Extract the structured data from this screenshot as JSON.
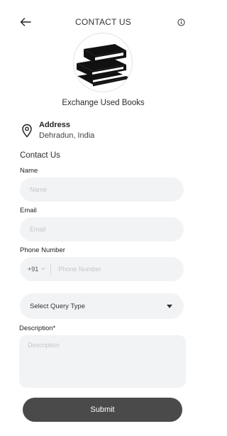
{
  "header": {
    "title": "CONTACT US",
    "back_icon": "arrow-left-icon",
    "info_icon": "info-icon"
  },
  "brand": {
    "name": "Exchange Used Books",
    "logo_icon": "books-stack-icon"
  },
  "address": {
    "icon": "location-pin-icon",
    "title": "Address",
    "value": "Dehradun, India"
  },
  "form": {
    "section_title": "Contact Us",
    "name_label": "Name",
    "name_placeholder": "Name",
    "email_label": "Email",
    "email_placeholder": "Email",
    "phone_label": "Phone Number",
    "country_code": "+91",
    "phone_placeholder": "Phone Number",
    "query_type": "Select Query Type",
    "description_label": "Description*",
    "description_placeholder": "Description",
    "submit_label": "Submit"
  },
  "colors": {
    "field_bg": "#f2f3f5",
    "button_bg": "#4a4a4a",
    "placeholder": "#c3c6cc"
  }
}
